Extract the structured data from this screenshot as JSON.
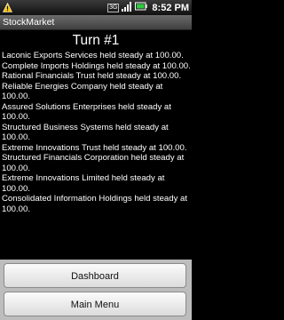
{
  "status_bar": {
    "icons": [
      "warning-icon",
      "3g-icon",
      "signal-icon",
      "battery-icon"
    ],
    "network_label": "3G",
    "time": "8:52 PM"
  },
  "app": {
    "title": "StockMarket"
  },
  "main": {
    "turn_title": "Turn #1",
    "events": [
      "Laconic Exports Services held steady at 100.00.",
      "Complete Imports Holdings held steady at 100.00.",
      "Rational Financials Trust held steady at 100.00.",
      "Reliable Energies Company held steady at 100.00.",
      "Assured Solutions Enterprises held steady at 100.00.",
      "Structured Business Systems held steady at 100.00.",
      "Extreme Innovations Trust held steady at 100.00.",
      "Structured Financials Corporation held steady at 100.00.",
      "Extreme Innovations Limited held steady at 100.00.",
      "Consolidated Information Holdings held steady at 100.00."
    ]
  },
  "buttons": {
    "dashboard_label": "Dashboard",
    "main_menu_label": "Main Menu"
  },
  "colors": {
    "background": "#000000",
    "text": "#ffffff",
    "button_area": "#bdbdbd"
  }
}
